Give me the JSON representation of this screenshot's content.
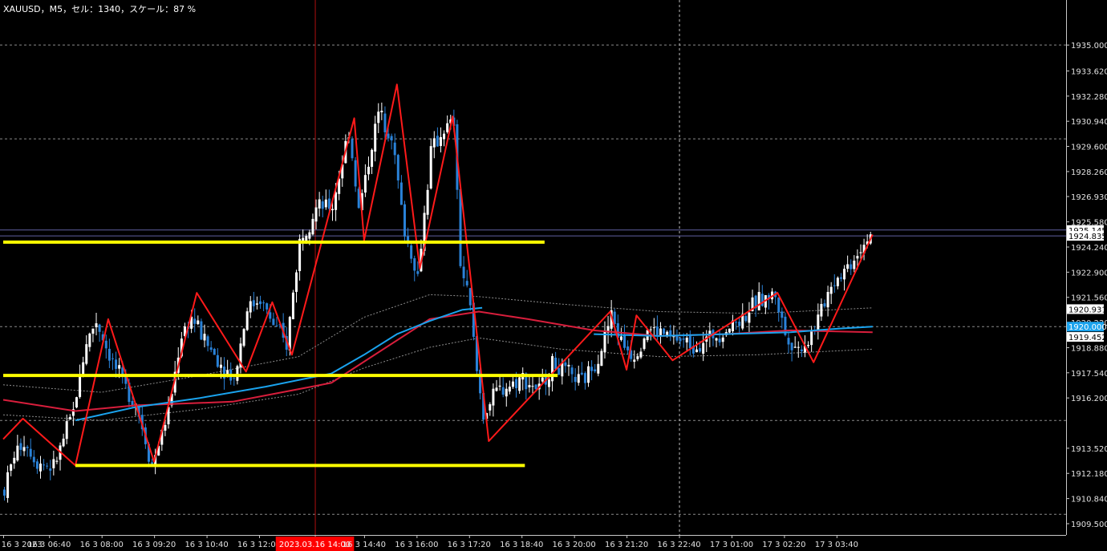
{
  "header": {
    "info_text": "XAUUSD，M5，セル：1340，スケール：87 %"
  },
  "colors": {
    "background": "#000000",
    "axis": "#c8c8c8",
    "grid": "#8a8a8a",
    "bull_candle": "#ffffff",
    "bear_candle": "#2a82d8",
    "zigzag": "#ff1a1a",
    "support_resistance": "#ffff00",
    "ma_blue": "#1aa3ee",
    "ma_red": "#d81e3c",
    "envelope": "#8c8c8c",
    "highlight_tag": "#ff0000",
    "price_tag_blue": "#1aa3ee",
    "bid_line": "#6060a0"
  },
  "chart_data": {
    "type": "candlestick",
    "symbol": "XAUUSD",
    "timeframe": "M5",
    "ylim": [
      1908.9,
      1937.4
    ],
    "y_ticks": [
      "1935.000",
      "1933.620",
      "1932.280",
      "1930.940",
      "1929.600",
      "1928.260",
      "1926.930",
      "1925.580",
      "1924.240",
      "1922.900",
      "1921.560",
      "1920.220",
      "1918.880",
      "1917.540",
      "1916.200",
      "1913.520",
      "1912.180",
      "1910.840",
      "1909.500"
    ],
    "round_levels": [
      "1935.000",
      "1930.000",
      "1920.000",
      "1915.000",
      "1910.000"
    ],
    "price_tags": [
      {
        "label": "1925.145",
        "price": 1925.145,
        "style": "white"
      },
      {
        "label": "1924.835",
        "price": 1924.835,
        "style": "white"
      },
      {
        "label": "1920.931",
        "price": 1920.931,
        "style": "white"
      },
      {
        "label": "1920.000",
        "price": 1920.0,
        "style": "blue"
      },
      {
        "label": "1919.452",
        "price": 1919.452,
        "style": "white"
      }
    ],
    "x_ticks": [
      "16 3 2023",
      "16 3 06:40",
      "16 3 08:00",
      "16 3 09:20",
      "16 3 10:40",
      "16 3 12:00",
      "2023.03.16 14:00",
      "16 3 14:40",
      "16 3 16:00",
      "16 3 17:20",
      "16 3 18:40",
      "16 3 20:00",
      "16 3 21:20",
      "16 3 22:40",
      "17 3 01:00",
      "17 3 02:20",
      "17 3 03:40"
    ],
    "x_tick_bar_index": [
      0,
      14,
      30,
      46,
      62,
      78,
      95,
      110,
      126,
      142,
      158,
      174,
      190,
      206,
      222,
      238,
      254
    ],
    "highlighted_x_label": "2023.03.16 14:00",
    "bars_total": 265,
    "candle_path": [
      [
        0,
        1911.3
      ],
      [
        3,
        1913.2
      ],
      [
        6,
        1913.9
      ],
      [
        10,
        1912.8
      ],
      [
        15,
        1912.5
      ],
      [
        21,
        1915.5
      ],
      [
        25,
        1919.2
      ],
      [
        28,
        1920.3
      ],
      [
        32,
        1918.5
      ],
      [
        36,
        1917.0
      ],
      [
        40,
        1916.0
      ],
      [
        45,
        1912.6
      ],
      [
        50,
        1915.5
      ],
      [
        54,
        1919.6
      ],
      [
        57,
        1920.5
      ],
      [
        62,
        1919.0
      ],
      [
        66,
        1918.0
      ],
      [
        70,
        1917.2
      ],
      [
        74,
        1921.0
      ],
      [
        78,
        1921.5
      ],
      [
        82,
        1920.1
      ],
      [
        86,
        1919.0
      ],
      [
        90,
        1924.6
      ],
      [
        95,
        1926.3
      ],
      [
        100,
        1926.4
      ],
      [
        105,
        1930.5
      ],
      [
        108,
        1926.2
      ],
      [
        114,
        1931.4
      ],
      [
        118,
        1930.3
      ],
      [
        122,
        1925.0
      ],
      [
        126,
        1922.7
      ],
      [
        130,
        1929.3
      ],
      [
        134,
        1930.5
      ],
      [
        137,
        1930.8
      ],
      [
        139,
        1923.4
      ],
      [
        142,
        1921.0
      ],
      [
        144,
        1917.6
      ],
      [
        146,
        1915.3
      ],
      [
        150,
        1916.5
      ],
      [
        154,
        1916.9
      ],
      [
        158,
        1917.3
      ],
      [
        163,
        1916.6
      ],
      [
        167,
        1918.0
      ],
      [
        171,
        1917.5
      ],
      [
        176,
        1917.0
      ],
      [
        181,
        1918.4
      ],
      [
        185,
        1920.6
      ],
      [
        188,
        1919.2
      ],
      [
        192,
        1918.5
      ],
      [
        196,
        1919.9
      ],
      [
        201,
        1919.6
      ],
      [
        205,
        1919.3
      ],
      [
        210,
        1919.0
      ],
      [
        216,
        1919.5
      ],
      [
        220,
        1919.9
      ],
      [
        225,
        1920.5
      ],
      [
        230,
        1921.4
      ],
      [
        235,
        1921.7
      ],
      [
        238,
        1919.6
      ],
      [
        242,
        1918.8
      ],
      [
        245,
        1919.3
      ],
      [
        248,
        1920.4
      ],
      [
        252,
        1922.3
      ],
      [
        258,
        1923.4
      ],
      [
        262,
        1924.5
      ],
      [
        264,
        1925.0
      ]
    ],
    "zigzag_points": [
      [
        0,
        1914.0
      ],
      [
        6,
        1915.1
      ],
      [
        22,
        1912.6
      ],
      [
        32,
        1920.4
      ],
      [
        46,
        1912.8
      ],
      [
        59,
        1921.8
      ],
      [
        74,
        1917.6
      ],
      [
        82,
        1921.3
      ],
      [
        88,
        1918.5
      ],
      [
        107,
        1931.1
      ],
      [
        110,
        1924.6
      ],
      [
        120,
        1932.9
      ],
      [
        127,
        1923.1
      ],
      [
        137,
        1931.2
      ],
      [
        148,
        1913.9
      ],
      [
        185,
        1920.8
      ],
      [
        190,
        1917.7
      ],
      [
        193,
        1920.6
      ],
      [
        204,
        1918.2
      ],
      [
        236,
        1921.8
      ],
      [
        247,
        1918.1
      ],
      [
        265,
        1924.9
      ]
    ],
    "support_resistance_levels": [
      {
        "price": 1924.5,
        "from_bar": 0,
        "to_bar": 165
      },
      {
        "price": 1917.4,
        "from_bar": 0,
        "to_bar": 169
      },
      {
        "price": 1912.6,
        "from_bar": 22,
        "to_bar": 159
      }
    ],
    "ma_blue": [
      [
        22,
        1915.0
      ],
      [
        40,
        1915.7
      ],
      [
        60,
        1916.2
      ],
      [
        80,
        1916.8
      ],
      [
        100,
        1917.5
      ],
      [
        110,
        1918.5
      ],
      [
        120,
        1919.6
      ],
      [
        130,
        1920.3
      ],
      [
        140,
        1920.9
      ],
      [
        146,
        1921.0
      ]
    ],
    "ma_blue_2": [
      [
        180,
        1919.6
      ],
      [
        200,
        1919.5
      ],
      [
        220,
        1919.6
      ],
      [
        240,
        1919.7
      ],
      [
        255,
        1919.9
      ],
      [
        265,
        1920.0
      ]
    ],
    "ma_red": [
      [
        0,
        1916.1
      ],
      [
        22,
        1915.5
      ],
      [
        40,
        1915.8
      ],
      [
        70,
        1916.0
      ],
      [
        100,
        1917.0
      ],
      [
        130,
        1920.4
      ],
      [
        145,
        1920.8
      ],
      [
        160,
        1920.4
      ],
      [
        180,
        1919.8
      ],
      [
        200,
        1919.5
      ],
      [
        220,
        1919.6
      ],
      [
        240,
        1919.8
      ],
      [
        265,
        1919.7
      ]
    ],
    "envelope_upper": [
      [
        0,
        1916.9
      ],
      [
        30,
        1916.5
      ],
      [
        60,
        1917.4
      ],
      [
        90,
        1918.4
      ],
      [
        110,
        1920.5
      ],
      [
        130,
        1921.7
      ],
      [
        145,
        1921.6
      ],
      [
        170,
        1921.2
      ],
      [
        200,
        1920.8
      ],
      [
        230,
        1920.7
      ],
      [
        265,
        1921.0
      ]
    ],
    "envelope_lower": [
      [
        0,
        1915.3
      ],
      [
        30,
        1915.0
      ],
      [
        60,
        1915.6
      ],
      [
        90,
        1916.4
      ],
      [
        110,
        1917.8
      ],
      [
        130,
        1918.9
      ],
      [
        145,
        1919.4
      ],
      [
        170,
        1918.8
      ],
      [
        200,
        1918.4
      ],
      [
        230,
        1918.5
      ],
      [
        265,
        1918.8
      ]
    ],
    "grid": true
  }
}
